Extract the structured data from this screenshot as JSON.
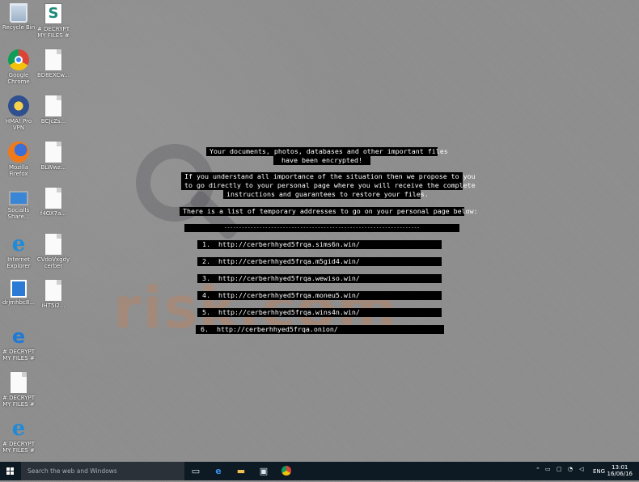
{
  "desktop_icons": [
    {
      "name": "recycle-bin-icon",
      "label": "Recycle Bin",
      "x": "l"
    },
    {
      "name": "decrypt-my-files-icon",
      "label": "# DECRYPT\nMY FILES #",
      "x": "r"
    },
    {
      "name": "chrome-icon",
      "label": "Google\nChrome",
      "x": "l"
    },
    {
      "name": "file-icon",
      "label": "BD8EXCw...",
      "x": "r"
    },
    {
      "name": "vpn-icon",
      "label": "HMA! Pro\nVPN",
      "x": "l"
    },
    {
      "name": "file-icon",
      "label": "BCJcZs...",
      "x": "r"
    },
    {
      "name": "firefox-icon",
      "label": "Mozilla\nFirefox",
      "x": "l"
    },
    {
      "name": "file-icon",
      "label": "BLWwz...",
      "x": "r"
    },
    {
      "name": "pc-icon",
      "label": "SocialIs\nShare...",
      "x": "l"
    },
    {
      "name": "file-icon",
      "label": "f4OX7a...",
      "x": "r"
    },
    {
      "name": "ie-icon",
      "label": "Internet\nExplorer",
      "x": "l"
    },
    {
      "name": "file-icon",
      "label": "CVdoVxgdy\ncerber",
      "x": "r"
    },
    {
      "name": "app-icon",
      "label": "drjmhbc8...",
      "x": "l"
    },
    {
      "name": "file-icon",
      "label": "iHT5i2...",
      "x": "r"
    },
    {
      "name": "decrypt-edge-icon",
      "label": "# DECRYPT\nMY FILES #",
      "x": "l"
    },
    {
      "name": "decrypt-text-icon",
      "label": "# DECRYPT\nMY FILES #",
      "x": "l"
    },
    {
      "name": "decrypt-ie-icon",
      "label": "# DECRYPT\nMY FILES #",
      "x": "l"
    }
  ],
  "note": {
    "line1": "Your documents, photos, databases and other important files",
    "line2": "have been encrypted!",
    "line3": "If you understand all importance of the situation then we propose to you",
    "line4": "to go directly to your personal page where you will receive the complete",
    "line5": "instructions and guarantees to restore your files.",
    "line6": "There is a list of temporary addresses to go on your personal page below:",
    "divider": "-------------------------------------------------------------------",
    "addresses": [
      "1.  http://cerberhhyed5frqa.sims6n.win/",
      "2.  http://cerberhhyed5frqa.m5gid4.win/",
      "3.  http://cerberhhyed5frqa.wewiso.win/",
      "4.  http://cerberhhyed5frqa.moneu5.win/",
      "5.  http://cerberhhyed5frqa.wins4n.win/",
      "6.  http://cerberhhyed5frqa.onion/"
    ]
  },
  "watermark": "risk.com",
  "taskbar": {
    "search_placeholder": "Search the web and Windows",
    "lang": "ENG",
    "time": "13:01",
    "date": "16/06/16"
  }
}
